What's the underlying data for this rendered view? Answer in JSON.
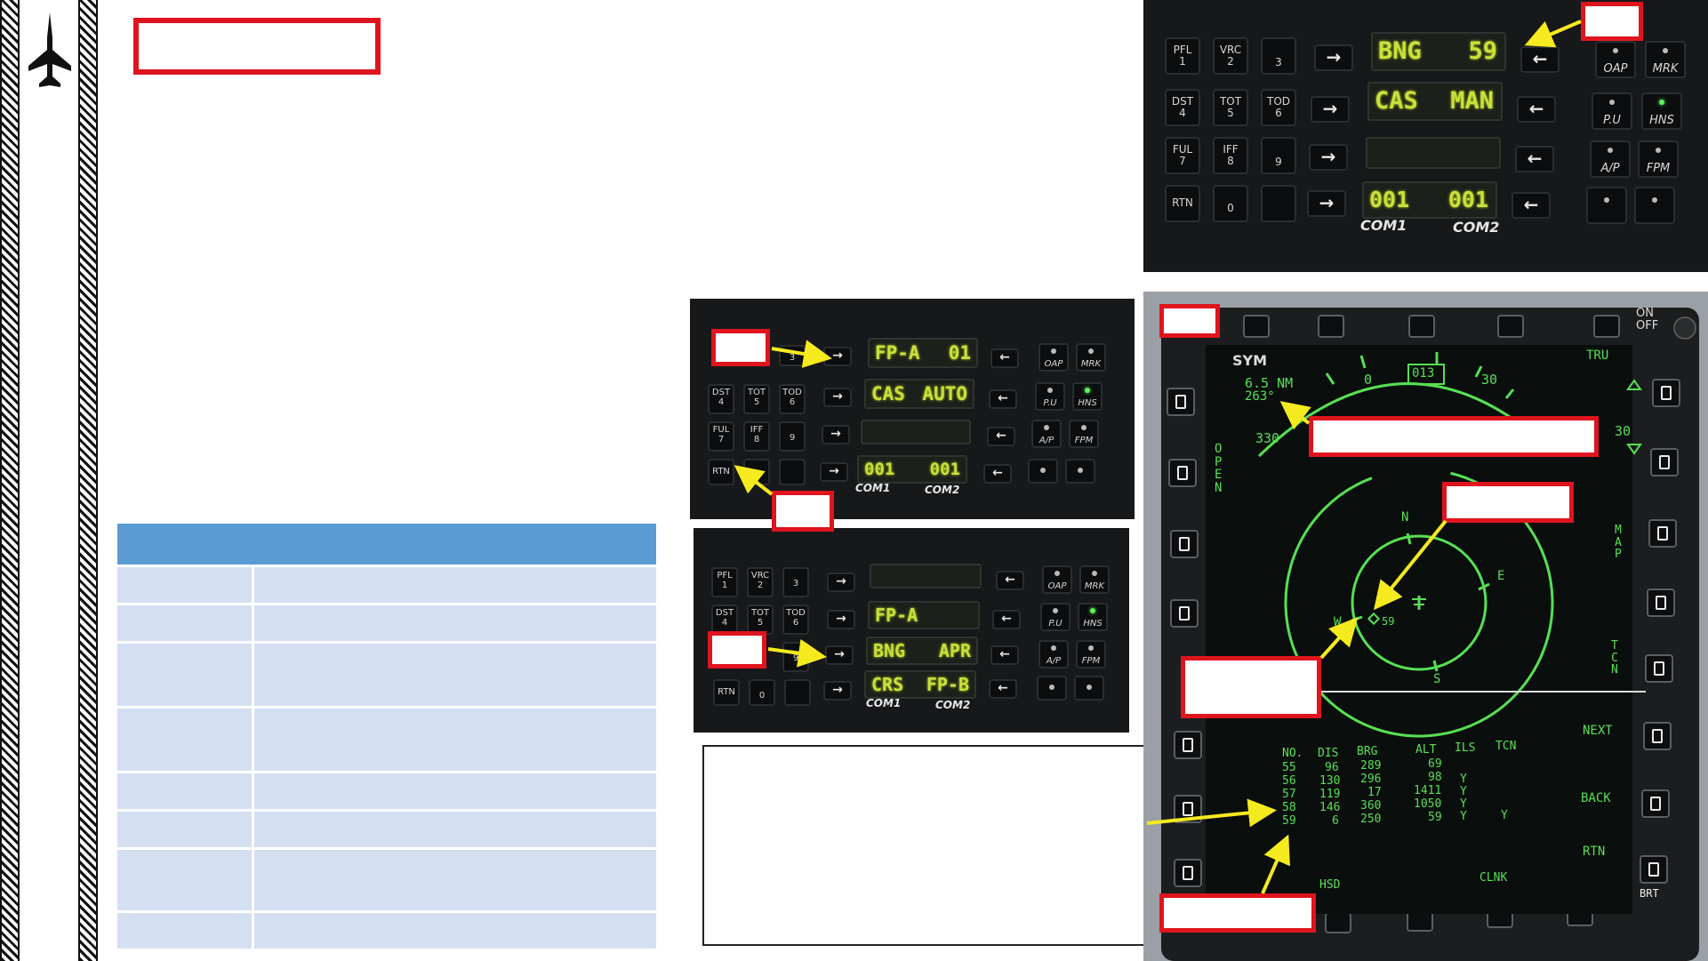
{
  "colors": {
    "accent_red": "#e0141e",
    "table_header": "#5b9bd5",
    "table_row": "#d4dff1",
    "lcd_text": "#c8e03a",
    "mfd_symbology": "#57e054",
    "callout_arrow": "#f5ea1e"
  },
  "sidebar": {
    "logo_icon": "jet-aircraft-icon"
  },
  "ufc_main": {
    "left_keys": [
      [
        {
          "top": "PFL",
          "bottom": "1"
        },
        {
          "top": "VRC",
          "bottom": "2"
        },
        {
          "top": "",
          "bottom": "3"
        }
      ],
      [
        {
          "top": "DST",
          "bottom": "4"
        },
        {
          "top": "TOT",
          "bottom": "5"
        },
        {
          "top": "TOD",
          "bottom": "6"
        }
      ],
      [
        {
          "top": "FUL",
          "bottom": "7"
        },
        {
          "top": "IFF",
          "bottom": "8"
        },
        {
          "top": "",
          "bottom": "9"
        }
      ],
      [
        {
          "top": "RTN",
          "bottom": ""
        },
        {
          "top": "",
          "bottom": "0"
        },
        {
          "top": "",
          "bottom": ""
        }
      ]
    ],
    "lines": [
      {
        "left": "BNG",
        "right": "59"
      },
      {
        "left": "CAS",
        "right": "MAN"
      },
      {
        "left": "",
        "right": ""
      },
      {
        "left": "001",
        "right": "001"
      }
    ],
    "right_keys": [
      [
        "OAP",
        "MRK"
      ],
      [
        "P.U",
        "HNS"
      ],
      [
        "A/P",
        "FPM"
      ],
      [
        "",
        ""
      ]
    ],
    "com_labels": [
      "COM1",
      "COM2"
    ],
    "arrow": "→",
    "arrow_left": "←"
  },
  "ufc_mid": {
    "lines": [
      {
        "left": "FP-A",
        "right": "01"
      },
      {
        "left": "CAS",
        "right": "AUTO"
      },
      {
        "left": "",
        "right": ""
      },
      {
        "left": "001",
        "right": "001"
      }
    ],
    "left_keys": [
      [
        {
          "top": "",
          "bottom": "3"
        }
      ],
      [
        {
          "top": "DST",
          "bottom": "4"
        },
        {
          "top": "TOT",
          "bottom": "5"
        },
        {
          "top": "TOD",
          "bottom": "6"
        }
      ],
      [
        {
          "top": "FUL",
          "bottom": "7"
        },
        {
          "top": "IFF",
          "bottom": "8"
        },
        {
          "top": "",
          "bottom": "9"
        }
      ],
      [
        {
          "top": "RTN",
          "bottom": ""
        },
        {
          "top": "",
          "bottom": "0"
        },
        {
          "top": "",
          "bottom": ""
        }
      ]
    ],
    "right_keys": [
      [
        "OAP",
        "MRK"
      ],
      [
        "P.U",
        "HNS"
      ],
      [
        "A/P",
        "FPM"
      ],
      [
        "",
        ""
      ]
    ],
    "com_labels": [
      "COM1",
      "COM2"
    ]
  },
  "ufc_low": {
    "lines": [
      {
        "left": "",
        "right": ""
      },
      {
        "left": "FP-A",
        "right": ""
      },
      {
        "left": "BNG",
        "right": "APR"
      },
      {
        "left": "CRS",
        "right": "FP-B"
      }
    ],
    "left_keys": [
      [
        {
          "top": "PFL",
          "bottom": "1"
        },
        {
          "top": "VRC",
          "bottom": "2"
        },
        {
          "top": "",
          "bottom": "3"
        }
      ],
      [
        {
          "top": "DST",
          "bottom": "4"
        },
        {
          "top": "TOT",
          "bottom": "5"
        },
        {
          "top": "TOD",
          "bottom": "6"
        }
      ],
      [
        {
          "top": "",
          "bottom": ""
        },
        {
          "top": "",
          "bottom": ""
        },
        {
          "top": "",
          "bottom": "9"
        }
      ],
      [
        {
          "top": "RTN",
          "bottom": ""
        },
        {
          "top": "",
          "bottom": "0"
        },
        {
          "top": "",
          "bottom": ""
        }
      ]
    ],
    "right_keys": [
      [
        "OAP",
        "MRK"
      ],
      [
        "P.U",
        "HNS"
      ],
      [
        "A/P",
        "FPM"
      ],
      [
        "",
        ""
      ]
    ],
    "com_labels": [
      "COM1",
      "COM2"
    ]
  },
  "mfd": {
    "top_left": "SYM",
    "on_off": [
      "ON",
      "OFF"
    ],
    "tru": "TRU",
    "range": "6.5 NM",
    "bearing": "263°",
    "heading_box": "013",
    "compass_ticks": [
      "0",
      "30",
      "330"
    ],
    "right_30": "30",
    "cardinals": {
      "n": "N",
      "e": "E",
      "w": "W",
      "s": "S"
    },
    "waypoint": "59",
    "left_label": "OPEN",
    "right_labels": [
      "MAP",
      "TCN"
    ],
    "nav_right": [
      "NEXT",
      "BACK",
      "RTN"
    ],
    "bottom_labels": [
      "HSD",
      "CLNK"
    ],
    "brt": "BRT",
    "table": {
      "headers": [
        "NO.",
        "DIS",
        "BRG",
        "ALT",
        "ILS",
        "TCN"
      ],
      "rows": [
        [
          "55",
          "96",
          "289",
          "69",
          "",
          ""
        ],
        [
          "56",
          "130",
          "296",
          "98",
          "Y",
          ""
        ],
        [
          "57",
          "119",
          "17",
          "1411",
          "Y",
          ""
        ],
        [
          "58",
          "146",
          "360",
          "1050",
          "Y",
          "Y"
        ],
        [
          "59",
          "6",
          "250",
          "59",
          "Y",
          ""
        ]
      ]
    }
  }
}
